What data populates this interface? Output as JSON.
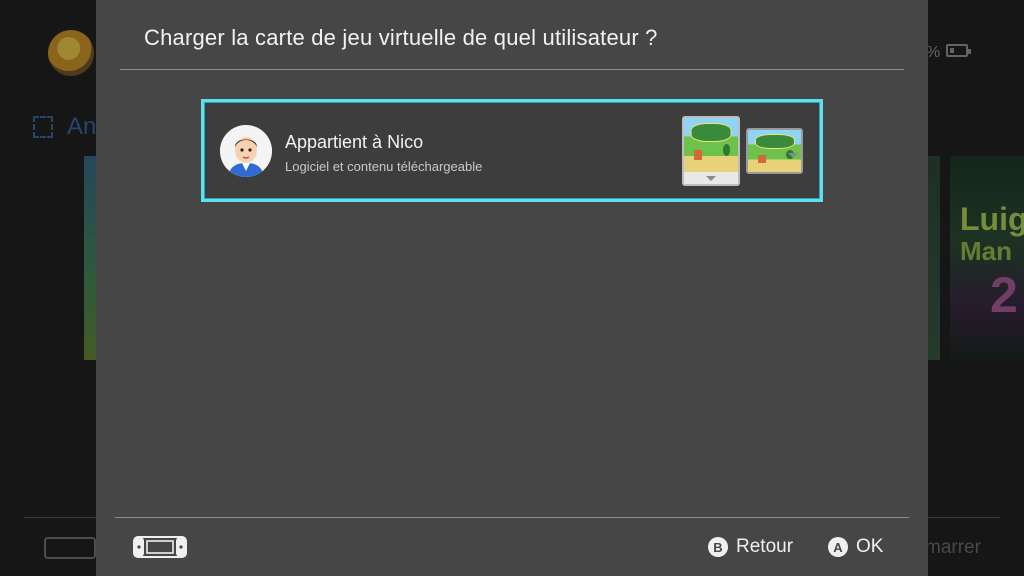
{
  "background": {
    "section_label": "An",
    "battery_percent": "%",
    "start_label": "marrer",
    "tile_right_line1": "Luig",
    "tile_right_line2": "Man",
    "tile_right_line3": "2"
  },
  "dialog": {
    "title": "Charger la carte de jeu virtuelle de quel utilisateur ?",
    "user_card": {
      "name": "Appartient à Nico",
      "subtitle": "Logiciel et contenu téléchargeable"
    },
    "footer": {
      "back_glyph": "B",
      "back_label": "Retour",
      "ok_glyph": "A",
      "ok_label": "OK"
    }
  },
  "icons": {
    "console": "handheld-console-icon",
    "battery": "battery-icon",
    "select": "select-bracket-icon"
  },
  "colors": {
    "dialog_bg": "#464646",
    "selection_border": "#5fe0ec",
    "accent_blue": "#3a6aa8"
  }
}
